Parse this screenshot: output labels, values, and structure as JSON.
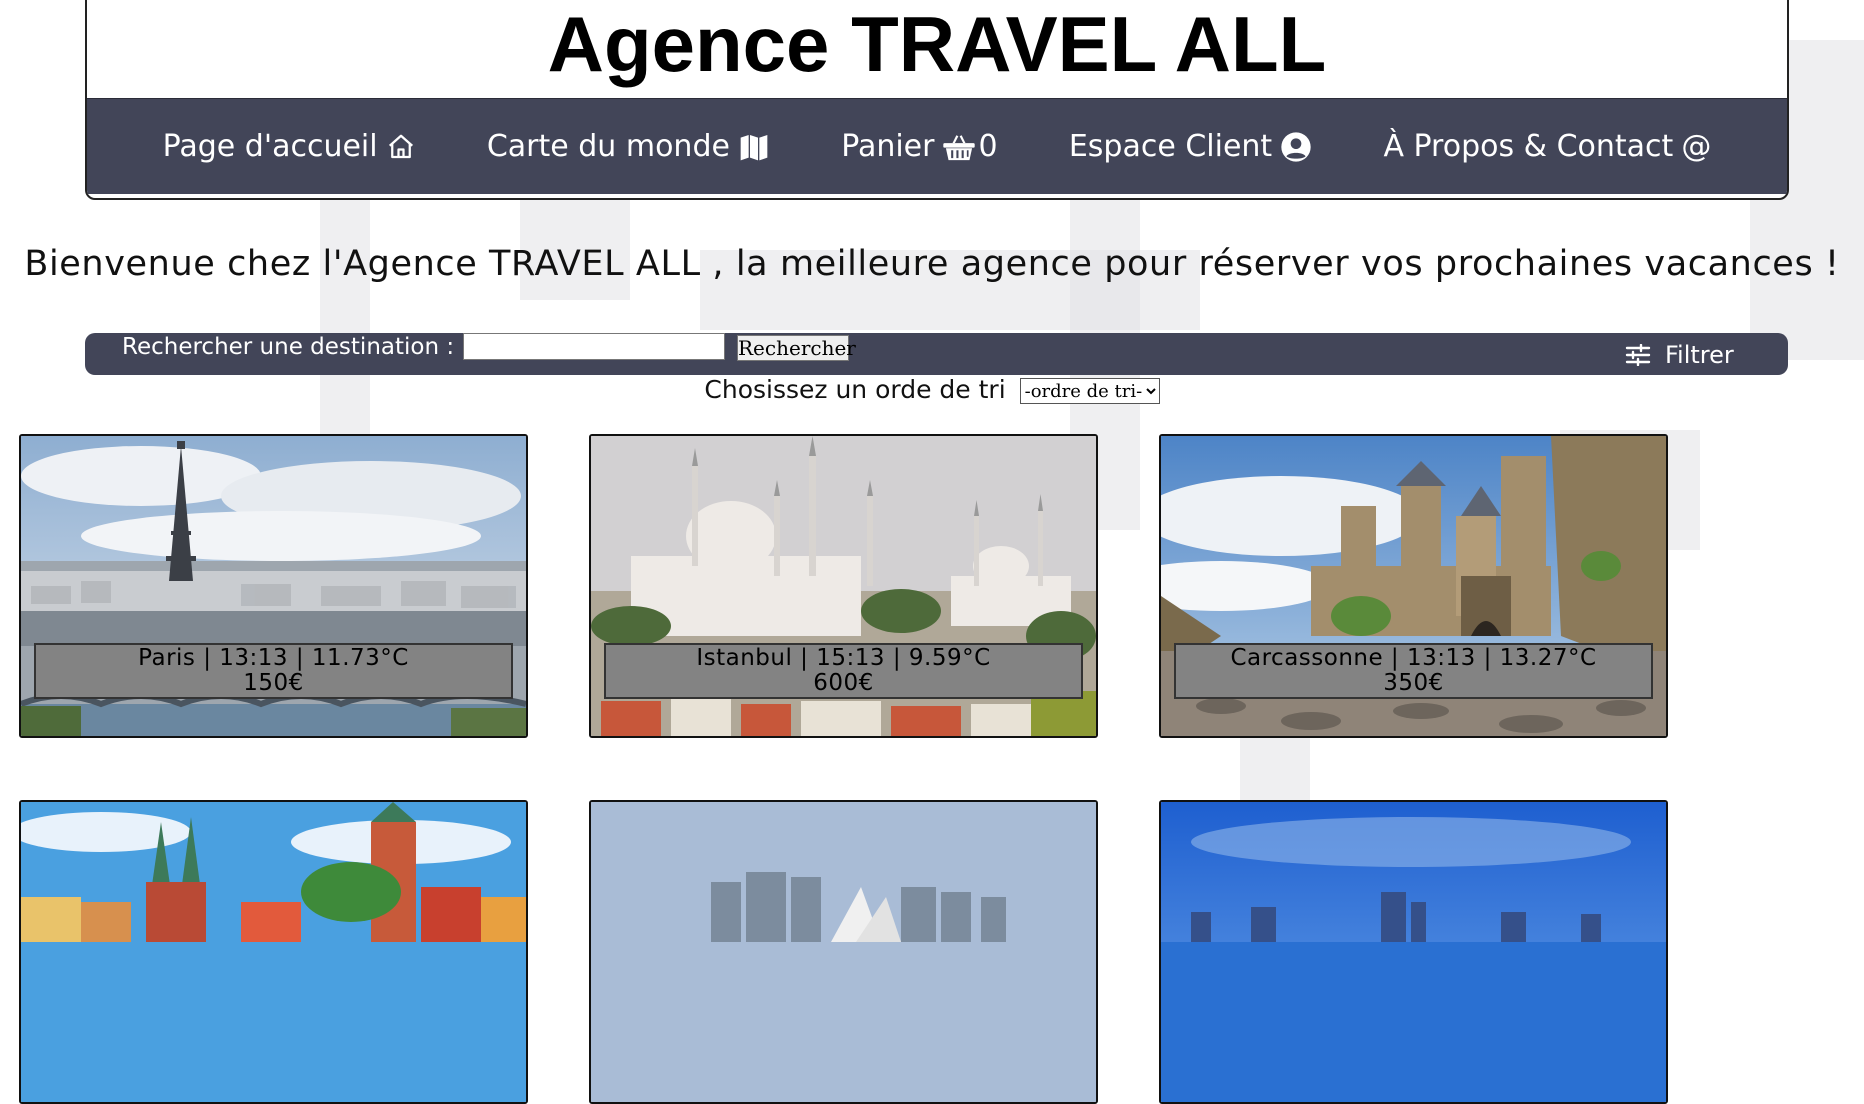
{
  "site": {
    "title": "Agence TRAVEL ALL"
  },
  "nav": {
    "items": [
      {
        "label": "Page d'accueil",
        "icon": "home-icon"
      },
      {
        "label": "Carte du monde",
        "icon": "map-icon"
      },
      {
        "label": "Panier",
        "icon": "basket-icon",
        "count": "0"
      },
      {
        "label": "Espace Client",
        "icon": "user-circle-icon"
      },
      {
        "label": "À Propos & Contact",
        "icon": "at-icon",
        "glyph": "@"
      }
    ]
  },
  "welcome": "Bienvenue chez l'Agence TRAVEL ALL , la meilleure agence pour réserver vos prochaines vacances !",
  "search": {
    "label": "Rechercher une destination :",
    "value": "",
    "placeholder": "",
    "button": "Rechercher",
    "filter_label": "Filtrer"
  },
  "sort": {
    "label": "Chosissez un orde de tri",
    "selected": "-ordre de tri-"
  },
  "destinations": [
    {
      "line1": "Paris | 13:13 | 11.73°C",
      "line2": "150€"
    },
    {
      "line1": "Istanbul | 15:13 | 9.59°C",
      "line2": "600€"
    },
    {
      "line1": "Carcassonne | 13:13 | 13.27°C",
      "line2": "350€"
    },
    {
      "line1": "",
      "line2": ""
    },
    {
      "line1": "",
      "line2": ""
    },
    {
      "line1": "",
      "line2": ""
    }
  ],
  "colors": {
    "nav_bg": "#424558",
    "info_bg": "#838383"
  }
}
